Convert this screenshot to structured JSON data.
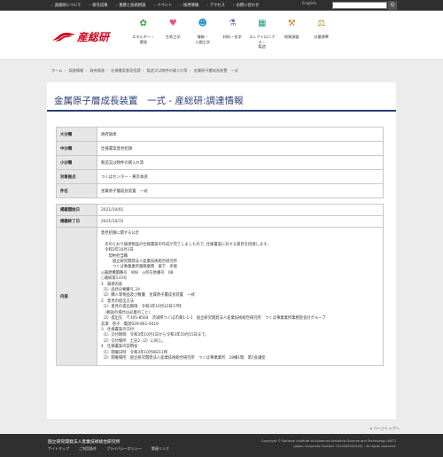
{
  "topbar": {
    "links": [
      "産総研について",
      "研究成果",
      "連携と技術相談",
      "イベント",
      "採用情報",
      "アクセス",
      "お問い合わせ"
    ],
    "lang": "English",
    "search_button": "Q"
  },
  "header": {
    "logo_text": "産総研",
    "nav": [
      {
        "label": "エネルギー・\n環境",
        "icon": "leaf-icon",
        "color": "#3a9a3a",
        "glyph": "✿"
      },
      {
        "label": "生命工学",
        "icon": "heart-icon",
        "color": "#e05a7a",
        "glyph": "♥"
      },
      {
        "label": "情報・\n人間工学",
        "icon": "person-icon",
        "color": "#2c8fc5",
        "glyph": "☻"
      },
      {
        "label": "材料・化学",
        "icon": "flask-icon",
        "color": "#8a5ab5",
        "glyph": "⚗"
      },
      {
        "label": "エレクトロニクス・\n製造",
        "icon": "chip-icon",
        "color": "#2d9a8a",
        "glyph": "▦"
      },
      {
        "label": "地質調査",
        "icon": "tools-icon",
        "color": "#d27a1a",
        "glyph": "⚒"
      },
      {
        "label": "計量標準",
        "icon": "scale-icon",
        "color": "#b58a1a",
        "glyph": "⚖"
      }
    ]
  },
  "breadcrumb": [
    "ホーム",
    "調達情報",
    "政府調達",
    "仕様書案意見招請",
    "製造又は物件の買入れ等",
    "金属原子層成長装置　一式"
  ],
  "page": {
    "title": "金属原子層成長装置　一式 - 産総研:調達情報"
  },
  "table1": [
    {
      "key": "大分類",
      "value": "政府調達"
    },
    {
      "key": "中分類",
      "value": "仕様書案意見招請"
    },
    {
      "key": "小分類",
      "value": "製造又は物件の買入れ等"
    },
    {
      "key": "対象拠点",
      "value": "つくばセンター・東京本部"
    },
    {
      "key": "件名",
      "value": "金属原子層成長装置　一式"
    }
  ],
  "table2": {
    "start_key": "掲載開始日",
    "start_value": "2021/10/01",
    "end_key": "掲載終了日",
    "end_value": "2021/10/15",
    "content_key": "内容",
    "content_text": "意見招請に関する公示\n\n　次のとおり調達物品の仕様書案の作成が完了しましたので, 仕様書案に対する意見を招請します。\n　令和3年10月1日\n　　契約担当職\n　　　国立研究開発法人産業技術総合研究所\n　　　つくば事業業所業務業務　富下　幸哉\n◎調達機関番号　908　◎所在地番号　08\n○通知第133号\n1　調達内容\n（1）品目分類番号 24\n（2）購入等物品及び数量　金属原子層成長装置　一式\n2　意見の提出方法\n（1）意見の提出期限　令和3年10月22日17時\n　（郵送の場合は必着のこと）\n（2）提出先　〒305-8564　茨城県つくば市東1-1-1　国立研究開発法人産業技術総合研究所　つくば事業業所業務室会計グループ\n北澤　智子　電話029-861-9419\n3　仕様書案の交付\n（1）交付期間　令和3年10月1日から令和3年10月15日まで。\n（2）交付場所　上記2（2）に同じ。\n4　仕様書案の説明会\n（1）開催日時　令和3年10月8日11時\n（2）開催場所　国立研究開発法人産業技術総合研究所　つくば事業業所　18棟1階　第1会議室"
  },
  "pagetop": "ページトップへ",
  "footer": {
    "org": "国立研究開発法人産業技術総合研究所",
    "links": [
      "サイトマップ",
      "ご利用条件",
      "プライバシーポリシー",
      "関連リンク"
    ],
    "copyright": "Copyright © National Institute of Advanced Industrial Science and Technology (AIST)",
    "corp_number": "(Japan Corporate Number 7010005005425) . All rights reserved."
  }
}
